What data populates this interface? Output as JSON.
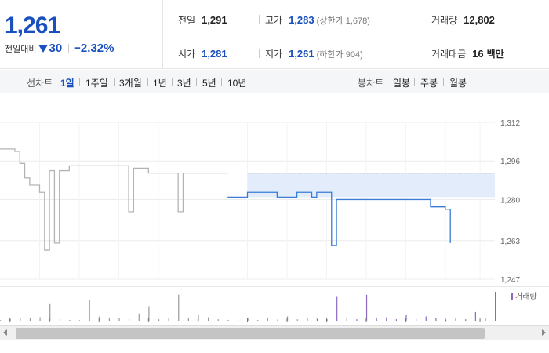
{
  "summary": {
    "current_price": "1,261",
    "change_label": "전일대비",
    "change_value": "30",
    "change_pct": "−2.32%",
    "prev_close": {
      "label": "전일",
      "value": "1,291"
    },
    "open": {
      "label": "시가",
      "value": "1,281"
    },
    "high": {
      "label": "고가",
      "value": "1,283",
      "sub": "(상한가 1,678)"
    },
    "low": {
      "label": "저가",
      "value": "1,261",
      "sub": "(하한가 904)"
    },
    "volume": {
      "label": "거래량",
      "value": "12,802"
    },
    "amount": {
      "label": "거래대금",
      "value": "16",
      "unit": "백만"
    }
  },
  "period_bar": {
    "line_label": "선차트",
    "line_items": [
      "1일",
      "1주일",
      "3개월",
      "1년",
      "3년",
      "5년",
      "10년"
    ],
    "active_line": "1일",
    "candle_label": "봉차트",
    "candle_items": [
      "일봉",
      "주봉",
      "월봉"
    ]
  },
  "chart_data": {
    "type": "line",
    "y_ticks": [
      "1,312",
      "1,296",
      "1,280",
      "1,263",
      "1,247"
    ],
    "ylim": [
      1247,
      1312
    ],
    "prev_close": 1291,
    "volume_label": "거래량",
    "series": [
      {
        "x": [
          0,
          0.03,
          0.04,
          0.05,
          0.06,
          0.07,
          0.08,
          0.09,
          0.1,
          0.11,
          0.12,
          0.13,
          0.14,
          0.2,
          0.25,
          0.26,
          0.27,
          0.28,
          0.3,
          0.35,
          0.36,
          0.37,
          0.38,
          0.4,
          0.45,
          0.46
        ],
        "y": [
          1301,
          1300,
          1295,
          1289,
          1286,
          1286,
          1283,
          1259,
          1292,
          1262,
          1292,
          1292,
          1294,
          1294,
          1294,
          1275,
          1293,
          1293,
          1291,
          1291,
          1275,
          1291,
          1291,
          1291,
          1291,
          1291
        ],
        "color": "#b3b3b3"
      },
      {
        "x": [
          0.46,
          0.5,
          0.55,
          0.56,
          0.6,
          0.62,
          0.63,
          0.64,
          0.66,
          0.67,
          0.68,
          0.7,
          0.75,
          0.8,
          0.86,
          0.87,
          0.9,
          0.91
        ],
        "y": [
          1281,
          1283,
          1283,
          1281,
          1283,
          1283,
          1281,
          1283,
          1283,
          1261,
          1280,
          1280,
          1280,
          1280,
          1280,
          1277,
          1276,
          1262
        ],
        "color": "#3a7bd5"
      }
    ],
    "volume_bars": [
      0.02,
      0.06,
      0.1,
      0.08,
      0.12,
      0.6,
      0.05,
      0.03,
      0.02,
      0.7,
      0.15,
      0.08,
      0.1,
      0.06,
      0.25,
      0.5,
      0.05,
      0.1,
      0.9,
      0.08,
      0.2,
      0.12,
      0.05,
      0.03,
      0.04,
      0.08,
      0.03,
      0.1,
      0.04,
      0.15,
      0.05,
      0.08,
      0.07,
      0.05,
      0.85,
      0.1,
      0.05,
      0.9,
      0.08,
      0.12,
      0.05,
      0.2,
      0.06,
      0.15,
      0.08,
      0.04,
      0.1,
      0.05,
      0.3,
      0.07,
      1.0
    ]
  }
}
